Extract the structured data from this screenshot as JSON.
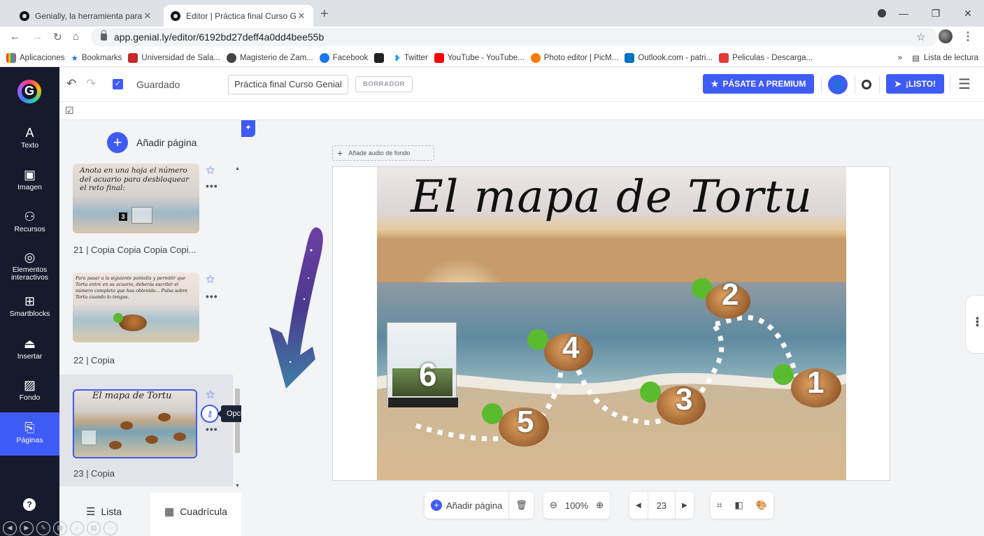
{
  "browser": {
    "tabs": [
      {
        "title": "Genially, la herramienta para cre",
        "close": "✕"
      },
      {
        "title": "Editor | Práctica final Curso Genia",
        "close": "✕"
      }
    ],
    "new_tab": "+",
    "url": "app.genial.ly/editor/6192bd27deff4a0dd4bee55b",
    "bookmarks": [
      {
        "label": "Aplicaciones",
        "color": "#ea4335"
      },
      {
        "label": "Bookmarks",
        "color": "#1a73e8"
      },
      {
        "label": "Universidad de Sala...",
        "color": "#c62828"
      },
      {
        "label": "Magisterio de Zam...",
        "color": "#444444"
      },
      {
        "label": "Facebook",
        "color": "#1877f2"
      },
      {
        "label": "",
        "color": "#222222"
      },
      {
        "label": "Twitter",
        "color": "#1da1f2"
      },
      {
        "label": "YouTube - YouTube...",
        "color": "#ff0000"
      },
      {
        "label": "Photo editor | PicM...",
        "color": "#ff7a00"
      },
      {
        "label": "Outlook.com - patri...",
        "color": "#0072c6"
      },
      {
        "label": "Peliculas - Descarga...",
        "color": "#e53935"
      }
    ],
    "bookmarks_more": "»",
    "reading_list": "Lista de lectura"
  },
  "rail": {
    "items": [
      {
        "label": "Texto",
        "icon": "A"
      },
      {
        "label": "Imagen",
        "icon": "▣"
      },
      {
        "label": "Recursos",
        "icon": "⚇"
      },
      {
        "label": "Elementos interactivos",
        "icon": "◎"
      },
      {
        "label": "Smartblocks",
        "icon": "⊞"
      },
      {
        "label": "Insertar",
        "icon": "⏏"
      },
      {
        "label": "Fondo",
        "icon": "▨"
      },
      {
        "label": "Páginas",
        "icon": "⎘"
      }
    ],
    "help": "?"
  },
  "topbar": {
    "saved_label": "Guardado",
    "title_value": "Práctica final Curso Genial",
    "draft_label": "BORRADOR",
    "premium_label": "PÁSATE A PREMIUM",
    "ready_label": "¡LISTO!"
  },
  "panel": {
    "add_page_label": "Añadir página",
    "pages": [
      {
        "label": "21 |  Copia Copia Copia Copi...",
        "thumb_text": "Anota en una hoja el número del acuario para desbloquear el reto final:"
      },
      {
        "label": "22 |  Copia",
        "thumb_text": "Para pasar a la siguiente pantalla y permitir que Tortu entre en su acuario, deberás escribir el número completo que has obtenido... Pulsa sobre Tortu cuando lo tengas."
      },
      {
        "label": "23 |  Copia",
        "thumb_text": "El mapa de Tortu"
      }
    ],
    "tooltip": "Opciones de contraseña",
    "tab_list": "Lista",
    "tab_grid": "Cuadrícula"
  },
  "canvas": {
    "audio_label": "Añade audio de fondo",
    "slide_title": "El mapa de Tortu",
    "turtle_numbers": [
      "1",
      "2",
      "3",
      "4",
      "5",
      "6"
    ]
  },
  "bottom_toolbar": {
    "add_page": "Añadir página",
    "zoom": "100%",
    "page_number": "23"
  }
}
